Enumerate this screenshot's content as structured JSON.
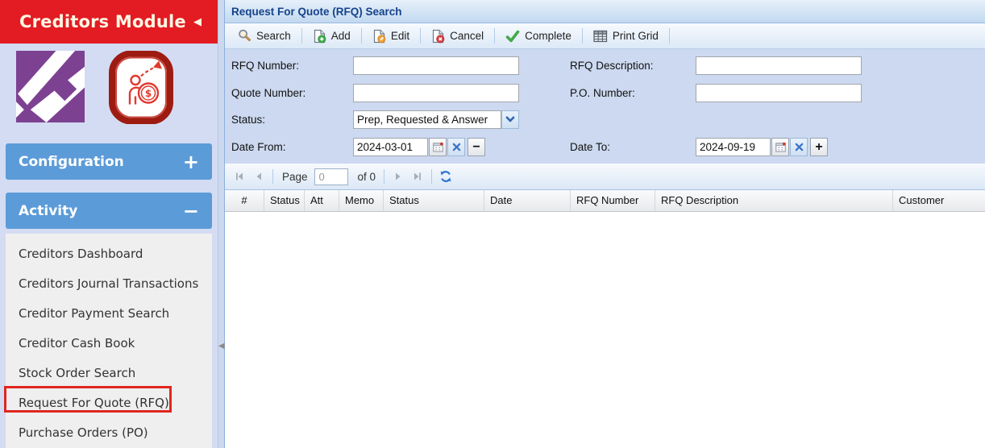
{
  "sidebar": {
    "title": "Creditors Module",
    "collapse_glyph": "◀",
    "sections": [
      {
        "label": "Configuration",
        "toggle_glyph": "+"
      },
      {
        "label": "Activity",
        "toggle_glyph": "−"
      }
    ],
    "menu_items": [
      "Creditors Dashboard",
      "Creditors Journal Transactions",
      "Creditor Payment Search",
      "Creditor Cash Book",
      "Stock Order Search",
      "Request For Quote (RFQ)",
      "Purchase Orders (PO)"
    ],
    "highlighted_item": "Request For Quote (RFQ)",
    "splitter_collapse_glyph": "◀"
  },
  "main": {
    "title": "Request For Quote (RFQ) Search",
    "toolbar": [
      {
        "label": "Search",
        "icon": "search-icon"
      },
      {
        "label": "Add",
        "icon": "doc-add-icon"
      },
      {
        "label": "Edit",
        "icon": "doc-edit-icon"
      },
      {
        "label": "Cancel",
        "icon": "doc-cancel-icon"
      },
      {
        "label": "Complete",
        "icon": "check-icon"
      },
      {
        "label": "Print Grid",
        "icon": "table-icon"
      }
    ],
    "form": {
      "rfq_number": {
        "label": "RFQ Number:",
        "value": ""
      },
      "quote_number": {
        "label": "Quote Number:",
        "value": ""
      },
      "status": {
        "label": "Status:",
        "value": "Prep, Requested & Answer"
      },
      "date_from": {
        "label": "Date From:",
        "value": "2024-03-01",
        "step_glyph": "−"
      },
      "rfq_description": {
        "label": "RFQ Description:",
        "value": ""
      },
      "po_number": {
        "label": "P.O. Number:",
        "value": ""
      },
      "date_to": {
        "label": "Date To:",
        "value": "2024-09-19",
        "step_glyph": "+"
      }
    },
    "pager": {
      "page_label": "Page",
      "page_value": "0",
      "of_label": "of 0"
    },
    "grid": {
      "columns": [
        "#",
        "Status",
        "Att",
        "Memo",
        "Status",
        "Date",
        "RFQ Number",
        "RFQ Description",
        "Customer"
      ]
    }
  },
  "icons": {
    "search-icon": "magnifying glass",
    "doc-add-icon": "document with green plus",
    "doc-edit-icon": "document with orange pencil",
    "doc-cancel-icon": "document with red x",
    "check-icon": "green checkmark",
    "table-icon": "print grid table",
    "calendar-icon": "date picker calendar",
    "clear-icon": "blue x clear field",
    "refresh-icon": "blue circular arrows",
    "combo-trigger-icon": "blue chevron down"
  },
  "colors": {
    "sidebar_red": "#e31b22",
    "accordion_blue": "#5b9bd8",
    "panel_title_text": "#15428b",
    "form_bg": "#ccd9f0",
    "highlight_border": "#e0261f"
  }
}
